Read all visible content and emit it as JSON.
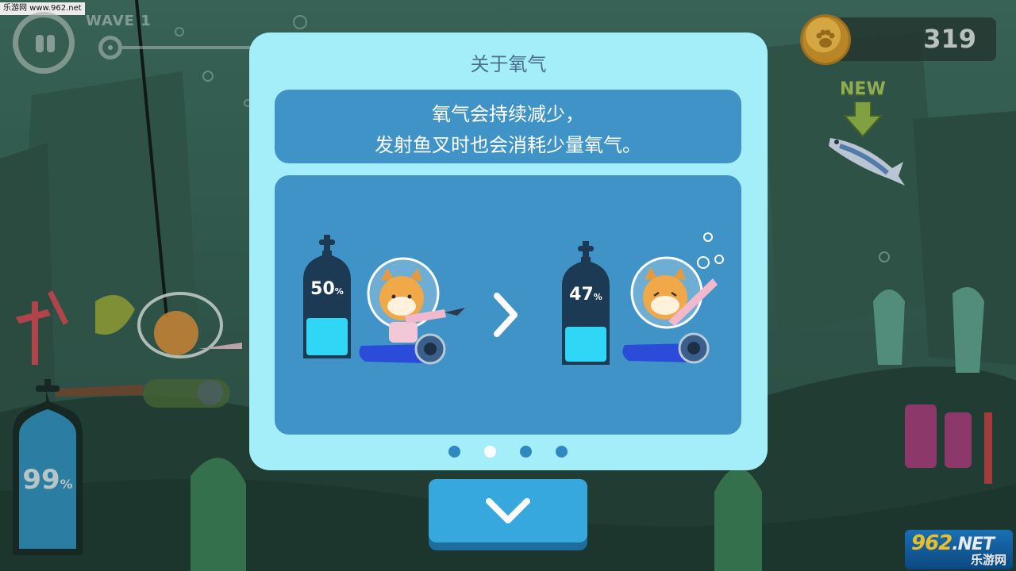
{
  "watermark_top": "乐游网 www.962.net",
  "hud": {
    "wave_label": "WAVE 1",
    "coins": "319",
    "new_badge": "NEW",
    "oxygen_value": "99",
    "oxygen_unit": "%"
  },
  "modal": {
    "title": "关于氧气",
    "description": [
      "氧气会持续减少，",
      "发射鱼叉时也会消耗少量氧气。"
    ],
    "illustration": {
      "before": {
        "value": "50",
        "unit": "%",
        "fill": 0.5
      },
      "after": {
        "value": "47",
        "unit": "%",
        "fill": 0.47
      }
    },
    "pager": {
      "total": 4,
      "active_index": 1
    }
  },
  "watermark_bottom": {
    "big": "962",
    "big_suffix": ".NET",
    "small": "乐游网"
  },
  "colors": {
    "modal_bg": "#a4eefa",
    "panel_bg": "#3f93c6",
    "oxygen_fill": "#2fd6f5",
    "button": "#36a8dd"
  },
  "icons": {
    "pause": "pause-icon",
    "coin": "paw-coin-icon",
    "next": "chevron-right-icon",
    "confirm": "chevron-down-icon"
  }
}
